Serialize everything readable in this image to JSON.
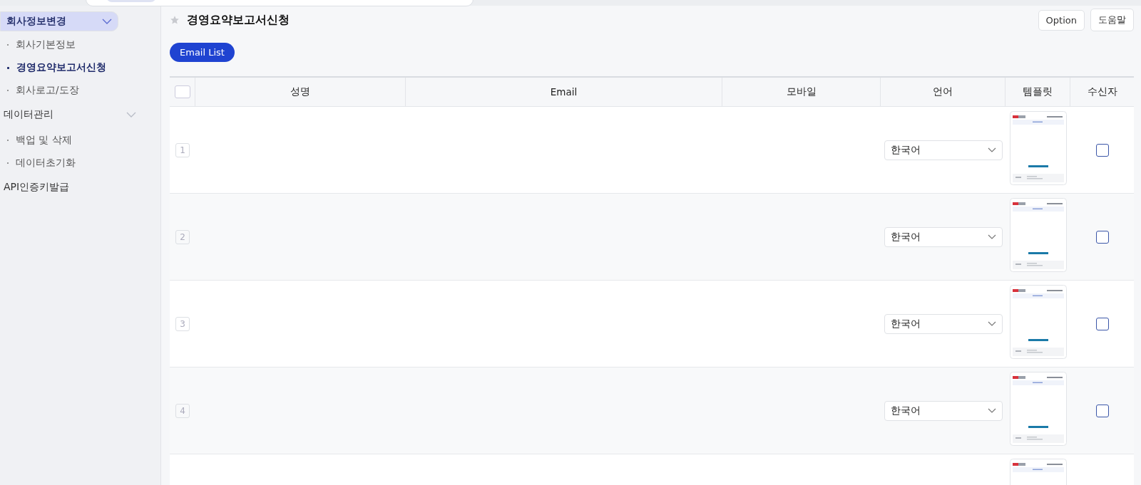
{
  "sidebar": {
    "groups": [
      {
        "label": "회사정보변경",
        "expanded": true,
        "selected": true,
        "children": [
          {
            "label": "회사기본정보",
            "selected": false
          },
          {
            "label": "경영요약보고서신청",
            "selected": true
          },
          {
            "label": "회사로고/도장",
            "selected": false
          }
        ]
      },
      {
        "label": "데이터관리",
        "expanded": true,
        "selected": false,
        "children": [
          {
            "label": "백업 및 삭제",
            "selected": false
          },
          {
            "label": "데이터초기화",
            "selected": false
          }
        ]
      },
      {
        "label": "API인증키발급",
        "selected": false
      }
    ]
  },
  "page": {
    "title": "경영요약보고서신청",
    "favorite": false,
    "buttons": [
      "Option",
      "도움말"
    ],
    "email_list_button": "Email List"
  },
  "table": {
    "header_checked": false,
    "columns": [
      "성명",
      "Email",
      "모바일",
      "언어",
      "템플릿",
      "수신자"
    ],
    "rows": [
      {
        "number": "1",
        "language": "한국어",
        "recipient_checked": false
      },
      {
        "number": "2",
        "language": "한국어",
        "recipient_checked": false
      },
      {
        "number": "3",
        "language": "한국어",
        "recipient_checked": false
      },
      {
        "number": "4",
        "language": "한국어",
        "recipient_checked": false
      },
      {}
    ]
  }
}
